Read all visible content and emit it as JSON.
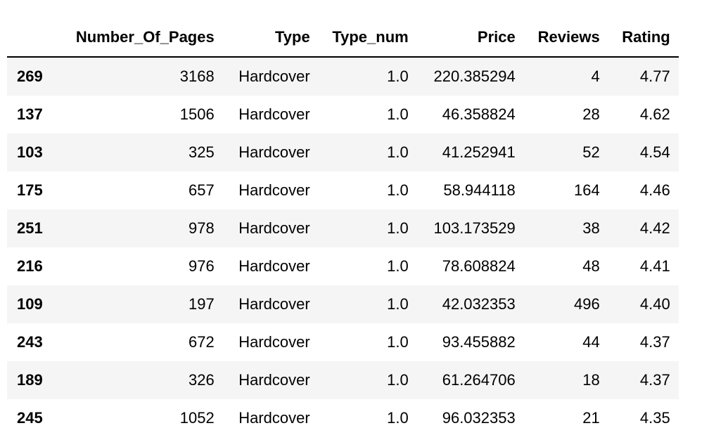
{
  "table": {
    "columns": [
      "",
      "Number_Of_Pages",
      "Type",
      "Type_num",
      "Price",
      "Reviews",
      "Rating"
    ],
    "rows": [
      {
        "index": "269",
        "pages": "3168",
        "type": "Hardcover",
        "type_num": "1.0",
        "price": "220.385294",
        "reviews": "4",
        "rating": "4.77"
      },
      {
        "index": "137",
        "pages": "1506",
        "type": "Hardcover",
        "type_num": "1.0",
        "price": "46.358824",
        "reviews": "28",
        "rating": "4.62"
      },
      {
        "index": "103",
        "pages": "325",
        "type": "Hardcover",
        "type_num": "1.0",
        "price": "41.252941",
        "reviews": "52",
        "rating": "4.54"
      },
      {
        "index": "175",
        "pages": "657",
        "type": "Hardcover",
        "type_num": "1.0",
        "price": "58.944118",
        "reviews": "164",
        "rating": "4.46"
      },
      {
        "index": "251",
        "pages": "978",
        "type": "Hardcover",
        "type_num": "1.0",
        "price": "103.173529",
        "reviews": "38",
        "rating": "4.42"
      },
      {
        "index": "216",
        "pages": "976",
        "type": "Hardcover",
        "type_num": "1.0",
        "price": "78.608824",
        "reviews": "48",
        "rating": "4.41"
      },
      {
        "index": "109",
        "pages": "197",
        "type": "Hardcover",
        "type_num": "1.0",
        "price": "42.032353",
        "reviews": "496",
        "rating": "4.40"
      },
      {
        "index": "243",
        "pages": "672",
        "type": "Hardcover",
        "type_num": "1.0",
        "price": "93.455882",
        "reviews": "44",
        "rating": "4.37"
      },
      {
        "index": "189",
        "pages": "326",
        "type": "Hardcover",
        "type_num": "1.0",
        "price": "61.264706",
        "reviews": "18",
        "rating": "4.37"
      },
      {
        "index": "245",
        "pages": "1052",
        "type": "Hardcover",
        "type_num": "1.0",
        "price": "96.032353",
        "reviews": "21",
        "rating": "4.35"
      }
    ]
  },
  "colors": {
    "stripe": "#f5f5f5",
    "header_rule": "#000000"
  }
}
